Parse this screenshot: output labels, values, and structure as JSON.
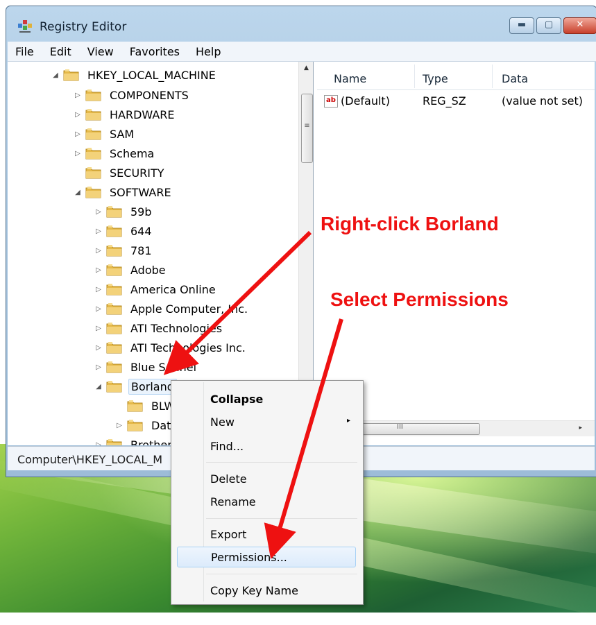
{
  "window": {
    "title": "Registry Editor"
  },
  "menubar": [
    "File",
    "Edit",
    "View",
    "Favorites",
    "Help"
  ],
  "tree": [
    {
      "label": "HKEY_LOCAL_MACHINE",
      "expander": "◢"
    },
    {
      "label": "COMPONENTS",
      "expander": "▷"
    },
    {
      "label": "HARDWARE",
      "expander": "▷"
    },
    {
      "label": "SAM",
      "expander": "▷"
    },
    {
      "label": "Schema",
      "expander": "▷"
    },
    {
      "label": "SECURITY",
      "expander": ""
    },
    {
      "label": "SOFTWARE",
      "expander": "◢"
    },
    {
      "label": "59b",
      "expander": "▷"
    },
    {
      "label": "644",
      "expander": "▷"
    },
    {
      "label": "781",
      "expander": "▷"
    },
    {
      "label": "Adobe",
      "expander": "▷"
    },
    {
      "label": "America Online",
      "expander": "▷"
    },
    {
      "label": "Apple Computer, Inc.",
      "expander": "▷"
    },
    {
      "label": "ATI Technologies",
      "expander": "▷"
    },
    {
      "label": "ATI Technologies Inc.",
      "expander": "▷"
    },
    {
      "label": "Blue Sonnel",
      "expander": "▷"
    },
    {
      "label": "Borland",
      "expander": "◢"
    },
    {
      "label": "BLW",
      "expander": ""
    },
    {
      "label": "Data",
      "expander": "▷"
    },
    {
      "label": "Brother",
      "expander": "▷"
    }
  ],
  "list": {
    "columns": [
      "Name",
      "Type",
      "Data"
    ],
    "rows": [
      {
        "name": "(Default)",
        "type": "REG_SZ",
        "data": "(value not set)"
      }
    ],
    "icon_text": "ab"
  },
  "status": {
    "path": "Computer\\HKEY_LOCAL_M"
  },
  "context_menu": {
    "items": [
      "Collapse",
      "New",
      "Find...",
      "Delete",
      "Rename",
      "Export",
      "Permissions...",
      "Copy Key Name"
    ],
    "submenu_glyph": "▸"
  },
  "annotations": {
    "right_click": "Right-click Borland",
    "select": "Select Permissions",
    "color": "#ee1111"
  },
  "window_buttons": {
    "minimize": "▬",
    "maximize": "▢",
    "close": "✕"
  },
  "scroll": {
    "up": "▲",
    "right": "▸",
    "grip": "≡",
    "hgrip": "III"
  }
}
